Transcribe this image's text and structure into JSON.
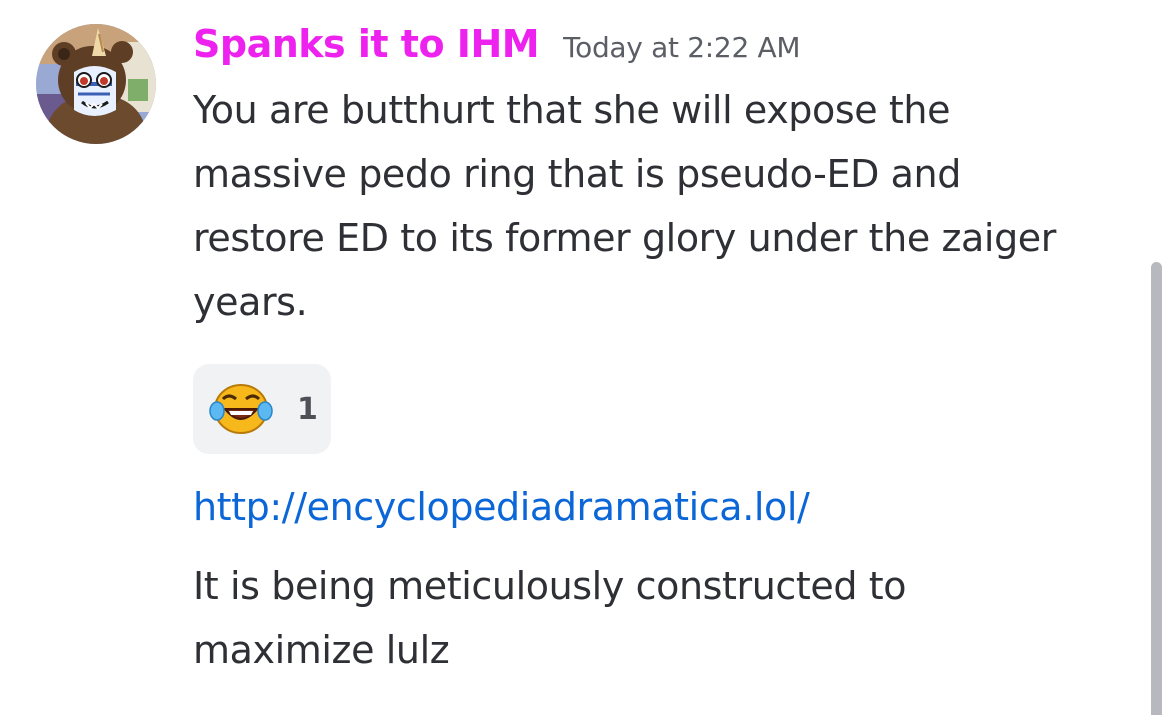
{
  "message": {
    "username": "Spanks it to IHM",
    "timestamp": "Today at 2:22 AM",
    "avatar_icon": "furry-character-avatar-icon",
    "text_lines": [
      "You are butthurt that she will expose the",
      "massive pedo ring that is pseudo-ED and",
      "restore ED to its former glory under the zaiger",
      "years."
    ],
    "reaction": {
      "emoji_icon": "laughing-crying-emoji-icon",
      "count": "1"
    },
    "link": "http://encyclopediadramatica.lol/",
    "text2_lines": [
      "It is being meticulously constructed to",
      "maximize lulz"
    ]
  },
  "colors": {
    "username": "#ee22ee",
    "link": "#0b66d8",
    "text": "#2e3035",
    "timestamp": "#5c5e66",
    "reaction_bg": "#f1f2f4"
  }
}
